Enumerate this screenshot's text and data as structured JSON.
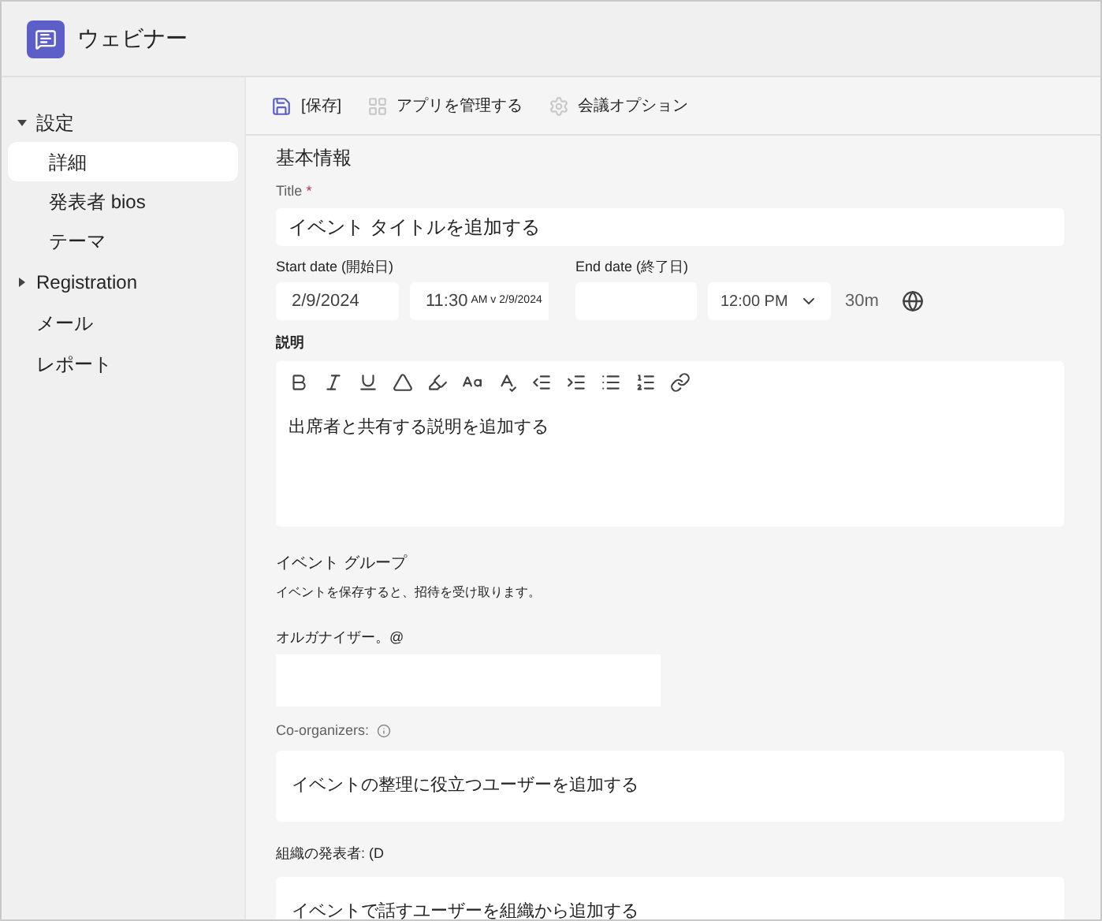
{
  "app": {
    "title": "ウェビナー"
  },
  "sidebar": {
    "items": [
      {
        "label": "設定",
        "kind": "group",
        "expanded": true,
        "selected": false,
        "children": [
          {
            "label": "詳細",
            "selected": true
          },
          {
            "label": "発表者 bios",
            "selected": false
          },
          {
            "label": "テーマ",
            "selected": false
          }
        ]
      },
      {
        "label": "Registration",
        "kind": "group",
        "expanded": false,
        "selected": false
      },
      {
        "label": "メール",
        "kind": "item",
        "selected": false
      },
      {
        "label": "レポート",
        "kind": "item",
        "selected": false
      }
    ]
  },
  "toolbar": [
    {
      "label": "[保存]",
      "kind": "save",
      "disabled": false
    },
    {
      "label": "アプリを管理する",
      "kind": "apps",
      "disabled": true
    },
    {
      "label": "会議オプション",
      "kind": "options",
      "disabled": true
    }
  ],
  "section_title": "基本情報",
  "title_field": {
    "label": "Title",
    "required_mark": "*",
    "placeholder": "イベント タイトルを追加する"
  },
  "start_date": {
    "label": "Start date (開始日)",
    "date": "2/9/2024",
    "time": "11:30",
    "time_suffix": "AM v 2/9/2024"
  },
  "end_date": {
    "label": "End date (終了日)",
    "time": "12:00 PM",
    "duration": "30m"
  },
  "description": {
    "label": "説明",
    "placeholder": "出席者と共有する説明を追加する"
  },
  "group": {
    "title": "イベント グループ",
    "note": "イベントを保存すると、招待を受け取ります。"
  },
  "organizer": {
    "label": "オルガナイザー。@"
  },
  "co_organizers": {
    "label": "Co-organizers:",
    "placeholder": "イベントの整理に役立つユーザーを追加する"
  },
  "presenters": {
    "label": "組織の発表者: (D",
    "placeholder": "イベントで話すユーザーを組織から追加する"
  }
}
